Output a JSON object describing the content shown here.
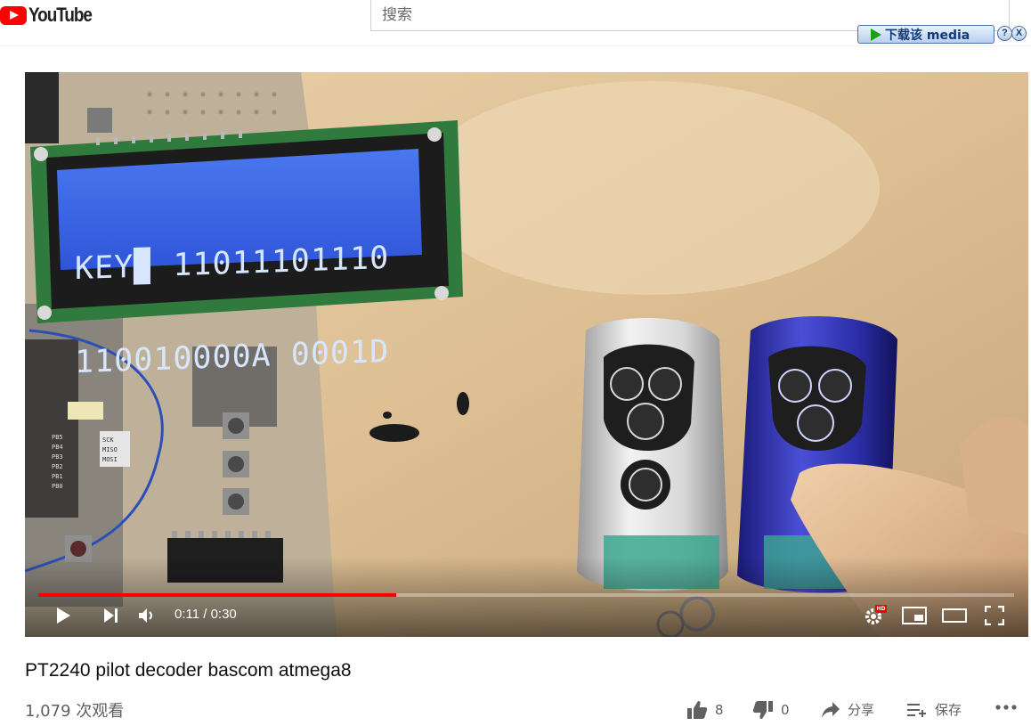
{
  "header": {
    "logo_text": "YouTube",
    "search_placeholder": "搜索",
    "download_button": "下载该 media",
    "download_help": "?",
    "download_close": "X"
  },
  "video": {
    "lcd_line1": "KEY▉ 11011101110",
    "lcd_line2": "110010000A 0001D",
    "board_labels": [
      "PB5",
      "PB4",
      "PB3",
      "PB2",
      "PB1",
      "PB0"
    ],
    "spi_labels": [
      "SCK",
      "MISO",
      "MOSI"
    ],
    "current_time": "0:11",
    "duration": "0:30",
    "time_text": "0:11 / 0:30",
    "progress_fraction": 0.367,
    "hd_badge": "HD"
  },
  "meta": {
    "title": "PT2240 pilot decoder bascom atmega8",
    "views": "1,079 次观看",
    "like_count": "8",
    "dislike_count": "0",
    "share_label": "分享",
    "save_label": "保存"
  },
  "colors": {
    "brand_red": "#ff0000",
    "lcd_blue": "#3f66e8",
    "pcb_green": "#2f7a3c"
  }
}
